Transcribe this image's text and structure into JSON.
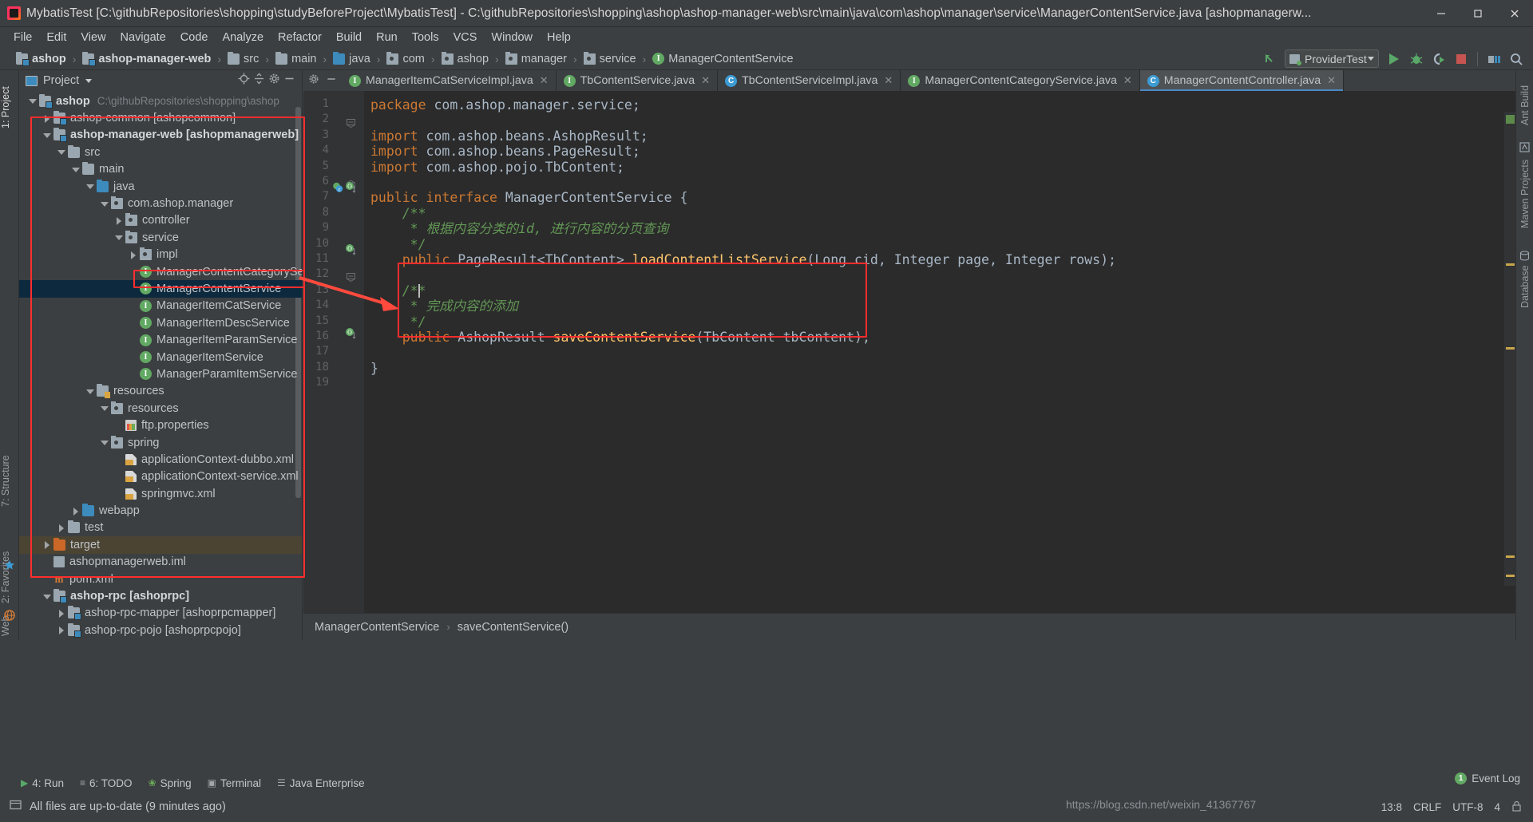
{
  "window": {
    "title": "MybatisTest [C:\\githubRepositories\\shopping\\studyBeforeProject\\MybatisTest] - C:\\githubRepositories\\shopping\\ashop\\ashop-manager-web\\src\\main\\java\\com\\ashop\\manager\\service\\ManagerContentService.java [ashopmanagerw...",
    "minimize": "–",
    "maximize": "❐",
    "close": "✕"
  },
  "menubar": {
    "items": [
      "File",
      "Edit",
      "View",
      "Navigate",
      "Code",
      "Analyze",
      "Refactor",
      "Build",
      "Run",
      "Tools",
      "VCS",
      "Window",
      "Help"
    ]
  },
  "navbar": {
    "crumbs": [
      {
        "label": "ashop",
        "icon": "module-folder-icon",
        "bold": true
      },
      {
        "label": "ashop-manager-web",
        "icon": "module-folder-icon",
        "bold": true
      },
      {
        "label": "src",
        "icon": "folder-icon",
        "bold": false
      },
      {
        "label": "main",
        "icon": "folder-icon",
        "bold": false
      },
      {
        "label": "java",
        "icon": "source-folder-icon",
        "bold": false
      },
      {
        "label": "com",
        "icon": "package-icon",
        "bold": false
      },
      {
        "label": "ashop",
        "icon": "package-icon",
        "bold": false
      },
      {
        "label": "manager",
        "icon": "package-icon",
        "bold": false
      },
      {
        "label": "service",
        "icon": "package-icon",
        "bold": false
      },
      {
        "label": "ManagerContentService",
        "icon": "interface-icon",
        "bold": false
      }
    ],
    "run_config": "ProviderTest",
    "icons": [
      "update-project-icon",
      "run-icon",
      "debug-icon",
      "run-coverage-icon",
      "stop-icon",
      "project-structure-icon",
      "search-everywhere-icon"
    ]
  },
  "left_strip": {
    "tabs": [
      "1: Project",
      "7: Structure",
      "2: Favorites",
      "Web"
    ]
  },
  "right_strip": {
    "tabs": [
      "Ant Build",
      "Maven Projects",
      "Database"
    ]
  },
  "project_panel": {
    "title": "Project",
    "actions": [
      "locate-icon",
      "collapse-all-icon",
      "settings-icon",
      "hide-icon"
    ],
    "tree": [
      {
        "indent": 0,
        "arrow": "down",
        "icon": "module-folder-icon",
        "label": "ashop",
        "bold": true,
        "path": "C:\\githubRepositories\\shopping\\ashop"
      },
      {
        "indent": 1,
        "arrow": "right",
        "icon": "module-folder-icon",
        "label": "ashop-common [ashopcommon]",
        "bold": false,
        "path": ""
      },
      {
        "indent": 1,
        "arrow": "down",
        "icon": "module-folder-icon",
        "label": "ashop-manager-web [ashopmanagerweb]",
        "bold": true,
        "path": ""
      },
      {
        "indent": 2,
        "arrow": "down",
        "icon": "folder-icon",
        "label": "src",
        "bold": false,
        "path": ""
      },
      {
        "indent": 3,
        "arrow": "down",
        "icon": "folder-icon",
        "label": "main",
        "bold": false,
        "path": ""
      },
      {
        "indent": 4,
        "arrow": "down",
        "icon": "source-folder-icon",
        "label": "java",
        "bold": false,
        "path": ""
      },
      {
        "indent": 5,
        "arrow": "down",
        "icon": "package-icon",
        "label": "com.ashop.manager",
        "bold": false,
        "path": ""
      },
      {
        "indent": 6,
        "arrow": "right",
        "icon": "package-icon",
        "label": "controller",
        "bold": false,
        "path": ""
      },
      {
        "indent": 6,
        "arrow": "down",
        "icon": "package-icon",
        "label": "service",
        "bold": false,
        "path": ""
      },
      {
        "indent": 7,
        "arrow": "right",
        "icon": "package-icon",
        "label": "impl",
        "bold": false,
        "path": ""
      },
      {
        "indent": 7,
        "arrow": "none",
        "icon": "interface-icon",
        "label": "ManagerContentCategoryServi",
        "bold": false,
        "path": ""
      },
      {
        "indent": 7,
        "arrow": "none",
        "icon": "interface-icon",
        "label": "ManagerContentService",
        "bold": false,
        "path": "",
        "selected": true
      },
      {
        "indent": 7,
        "arrow": "none",
        "icon": "interface-icon",
        "label": "ManagerItemCatService",
        "bold": false,
        "path": ""
      },
      {
        "indent": 7,
        "arrow": "none",
        "icon": "interface-icon",
        "label": "ManagerItemDescService",
        "bold": false,
        "path": ""
      },
      {
        "indent": 7,
        "arrow": "none",
        "icon": "interface-icon",
        "label": "ManagerItemParamService",
        "bold": false,
        "path": ""
      },
      {
        "indent": 7,
        "arrow": "none",
        "icon": "interface-icon",
        "label": "ManagerItemService",
        "bold": false,
        "path": ""
      },
      {
        "indent": 7,
        "arrow": "none",
        "icon": "interface-icon",
        "label": "ManagerParamItemService",
        "bold": false,
        "path": ""
      },
      {
        "indent": 4,
        "arrow": "down",
        "icon": "resources-folder-icon",
        "label": "resources",
        "bold": false,
        "path": ""
      },
      {
        "indent": 5,
        "arrow": "down",
        "icon": "package-icon",
        "label": "resources",
        "bold": false,
        "path": ""
      },
      {
        "indent": 6,
        "arrow": "none",
        "icon": "properties-file-icon",
        "label": "ftp.properties",
        "bold": false,
        "path": ""
      },
      {
        "indent": 5,
        "arrow": "down",
        "icon": "package-icon",
        "label": "spring",
        "bold": false,
        "path": ""
      },
      {
        "indent": 6,
        "arrow": "none",
        "icon": "spring-xml-icon",
        "label": "applicationContext-dubbo.xml",
        "bold": false,
        "path": ""
      },
      {
        "indent": 6,
        "arrow": "none",
        "icon": "spring-xml-icon",
        "label": "applicationContext-service.xml",
        "bold": false,
        "path": ""
      },
      {
        "indent": 6,
        "arrow": "none",
        "icon": "spring-xml-icon",
        "label": "springmvc.xml",
        "bold": false,
        "path": ""
      },
      {
        "indent": 3,
        "arrow": "right",
        "icon": "source-folder-icon",
        "label": "webapp",
        "bold": false,
        "path": ""
      },
      {
        "indent": 2,
        "arrow": "right",
        "icon": "folder-icon",
        "label": "test",
        "bold": false,
        "path": ""
      },
      {
        "indent": 1,
        "arrow": "right",
        "icon": "excluded-folder-icon",
        "label": "target",
        "bold": false,
        "path": "",
        "highlight": true
      },
      {
        "indent": 1,
        "arrow": "none",
        "icon": "iml-file-icon",
        "label": "ashopmanagerweb.iml",
        "bold": false,
        "path": ""
      },
      {
        "indent": 1,
        "arrow": "none",
        "icon": "maven-pom-icon",
        "label": "pom.xml",
        "bold": false,
        "path": ""
      },
      {
        "indent": 1,
        "arrow": "down",
        "icon": "module-folder-icon",
        "label": "ashop-rpc [ashoprpc]",
        "bold": true,
        "path": ""
      },
      {
        "indent": 2,
        "arrow": "right",
        "icon": "module-folder-icon",
        "label": "ashop-rpc-mapper [ashoprpcmapper]",
        "bold": false,
        "path": ""
      },
      {
        "indent": 2,
        "arrow": "right",
        "icon": "module-folder-icon",
        "label": "ashop-rpc-pojo [ashoprpcpojo]",
        "bold": false,
        "path": ""
      }
    ]
  },
  "editor": {
    "tabs": [
      {
        "label": "ManagerItemCatServiceImpl.java",
        "icon": "interface-icon",
        "active": false
      },
      {
        "label": "TbContentService.java",
        "icon": "interface-icon",
        "active": false
      },
      {
        "label": "TbContentServiceImpl.java",
        "icon": "class-icon",
        "active": false
      },
      {
        "label": "ManagerContentCategoryService.java",
        "icon": "interface-icon",
        "active": false
      },
      {
        "label": "ManagerContentController.java",
        "icon": "class-icon",
        "active": true
      }
    ],
    "tab_close": "✕",
    "lines": [
      {
        "n": 1,
        "text": "package com.ashop.manager.service;"
      },
      {
        "n": 2,
        "text": ""
      },
      {
        "n": 3,
        "text": "import com.ashop.beans.AshopResult;"
      },
      {
        "n": 4,
        "text": "import com.ashop.beans.PageResult;"
      },
      {
        "n": 5,
        "text": "import com.ashop.pojo.TbContent;"
      },
      {
        "n": 6,
        "text": ""
      },
      {
        "n": 7,
        "text": "public interface ManagerContentService {"
      },
      {
        "n": 8,
        "text": "    /**"
      },
      {
        "n": 9,
        "text": "     * 根据内容分类的id, 进行内容的分页查询"
      },
      {
        "n": 10,
        "text": "     */"
      },
      {
        "n": 11,
        "text": "    public PageResult<TbContent> loadContentListService(Long cid, Integer page, Integer rows);"
      },
      {
        "n": 12,
        "text": ""
      },
      {
        "n": 13,
        "text": "    /**"
      },
      {
        "n": 14,
        "text": "     * 完成内容的添加"
      },
      {
        "n": 15,
        "text": "     */"
      },
      {
        "n": 16,
        "text": "    public AshopResult saveContentService(TbContent tbContent);"
      },
      {
        "n": 17,
        "text": ""
      },
      {
        "n": 18,
        "text": "}"
      },
      {
        "n": 19,
        "text": ""
      }
    ],
    "breadcrumb": [
      "ManagerContentService",
      "saveContentService()"
    ],
    "breadcrumb_sep": "›"
  },
  "bottom_bar": {
    "items": [
      {
        "label": "4: Run",
        "icon": "run-icon",
        "underline": "4"
      },
      {
        "label": "6: TODO",
        "icon": "todo-icon",
        "underline": "6"
      },
      {
        "label": "Spring",
        "icon": "spring-icon",
        "underline": ""
      },
      {
        "label": "Terminal",
        "icon": "terminal-icon",
        "underline": ""
      },
      {
        "label": "Java Enterprise",
        "icon": "java-ee-icon",
        "underline": ""
      }
    ]
  },
  "status_bar": {
    "message": "All files are up-to-date (9 minutes ago)",
    "event_log": "Event Log",
    "caret_info": "13:8",
    "line_sep": "CRLF",
    "encoding": "UTF-8",
    "indent": "4"
  },
  "watermark": "https://blog.csdn.net/weixin_41367767",
  "colors": {
    "annotation_red": "#ff2d2d",
    "selection_blue": "#0d293e",
    "editor_bg": "#2b2b2b",
    "panel_bg": "#3c3f41",
    "keyword_orange": "#cc7832",
    "method_yellow": "#ffc66d",
    "comment_green": "#629755",
    "text_grey": "#a9b7c6"
  }
}
